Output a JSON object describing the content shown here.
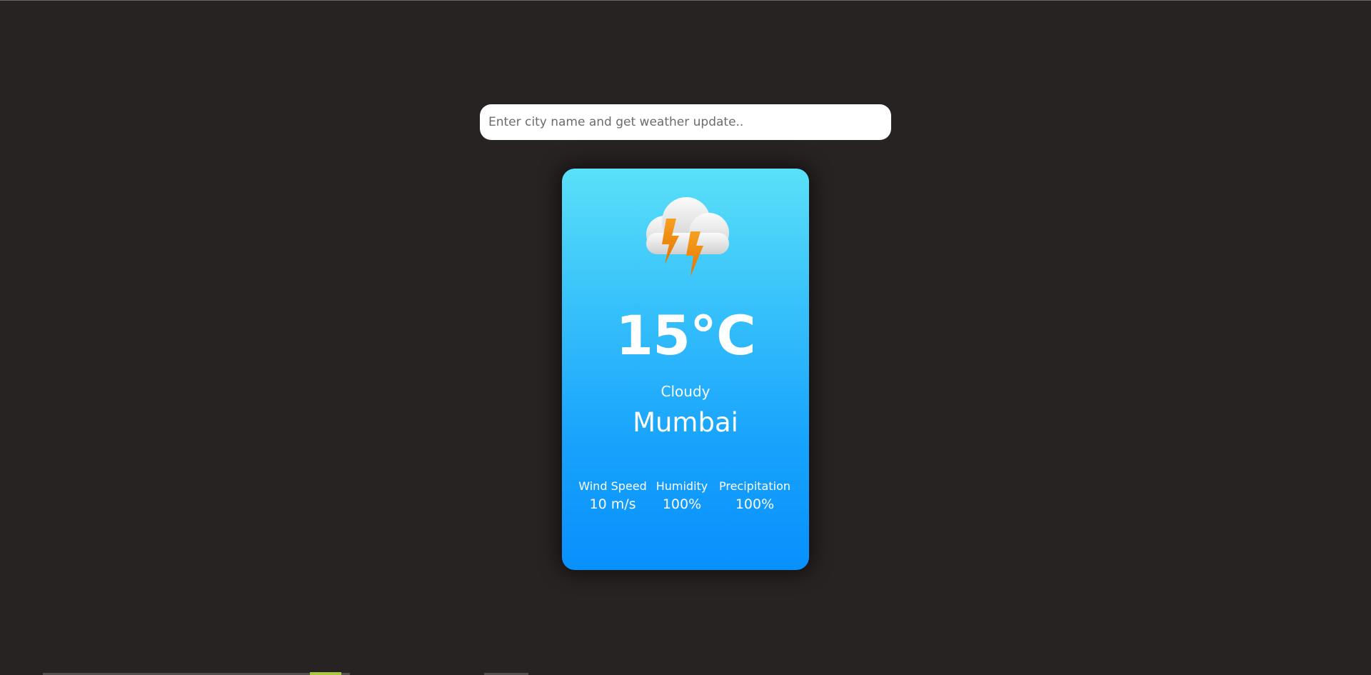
{
  "search": {
    "placeholder": "Enter city name and get weather update..",
    "value": ""
  },
  "weather": {
    "icon": "cloud-lightning-icon",
    "temperature": "15°C",
    "condition": "Cloudy",
    "city": "Mumbai"
  },
  "stats": [
    {
      "label": "Wind Speed",
      "value": "10 m/s"
    },
    {
      "label": "Humidity",
      "value": "100%"
    },
    {
      "label": "Precipitation",
      "value": "100%"
    }
  ],
  "colors": {
    "background": "#282323",
    "card_gradient_top": "#5ae0f8",
    "card_gradient_bottom": "#0890fd",
    "bolt": "#f08a00",
    "text": "#ffffff"
  }
}
